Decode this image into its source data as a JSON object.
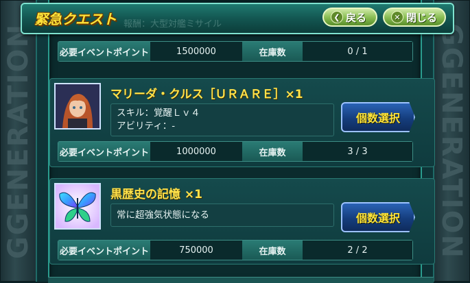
{
  "frame": {
    "side_text": "GGENERATION"
  },
  "header": {
    "title": "緊急クエスト",
    "ghost_subtitle": "報酬：大型対艦ミサイル",
    "back_label": "戻る",
    "close_label": "閉じる"
  },
  "first_bar": {
    "points_label": "必要イベントポイント",
    "points_value": "1500000",
    "stock_label": "在庫数",
    "stock_value": "0 / 1"
  },
  "items": [
    {
      "name": "マリーダ・クルス［ＵＲＡＲＥ］×1",
      "desc_line1": "スキル：覚醒Ｌｖ４",
      "desc_line2": "アビリティ：-",
      "button_label": "個数選択",
      "points_label": "必要イベントポイント",
      "points_value": "1000000",
      "stock_label": "在庫数",
      "stock_value": "3 / 3"
    },
    {
      "name": "黒歴史の記憶 ×1",
      "desc_line1": "常に超強気状態になる",
      "button_label": "個数選択",
      "points_label": "必要イベントポイント",
      "points_value": "750000",
      "stock_label": "在庫数",
      "stock_value": "2 / 2"
    }
  ],
  "colors": {
    "title_yellow": "#ffe53a",
    "panel_teal": "#0f3a3d",
    "button_blue": "#153d7d",
    "header_button_green": "#8bbf56"
  }
}
